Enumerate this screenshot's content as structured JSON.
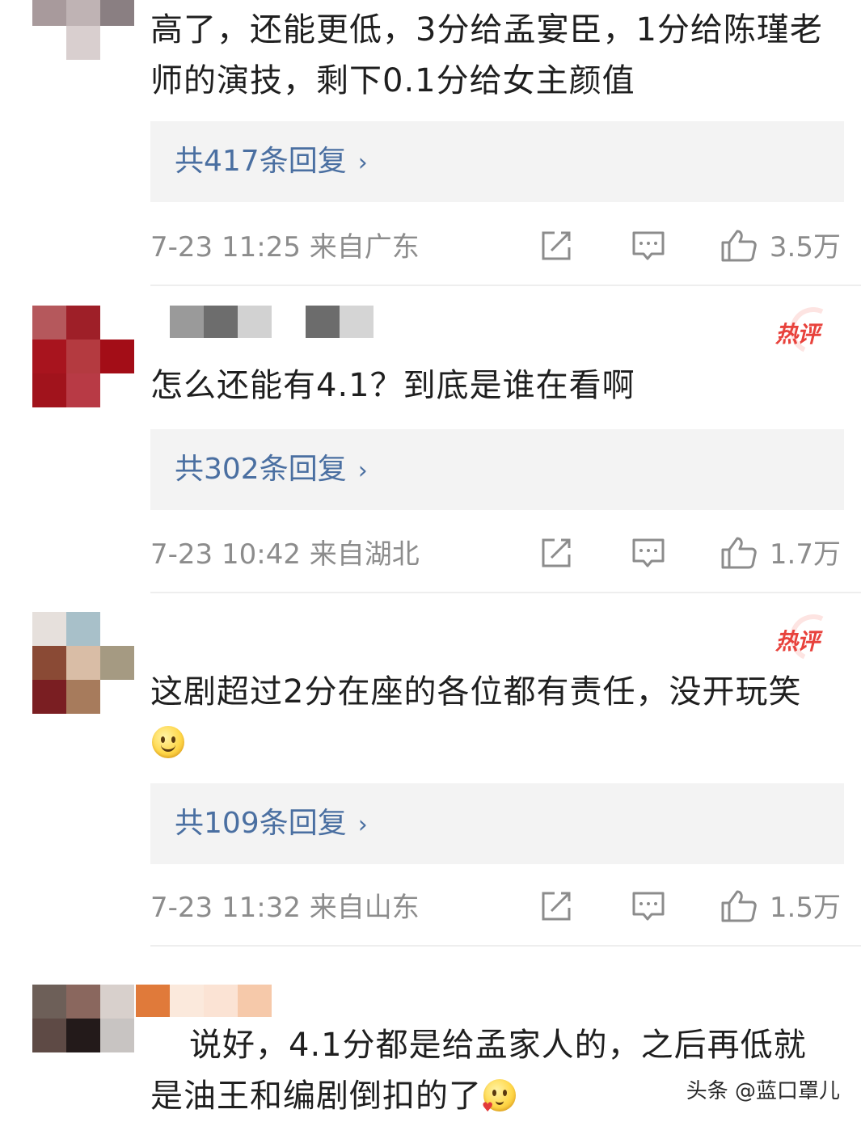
{
  "comments": [
    {
      "text": "高了，还能更低，3分给孟宴臣，1分给陈瑾老师的演技，剩下0.1分给女主颜值",
      "reply_label": "共417条回复",
      "time": "7-23 11:25",
      "location": "来自广东",
      "likes": "3.5万"
    },
    {
      "badge": "热评",
      "text": "怎么还能有4.1？到底是谁在看啊",
      "reply_label": "共302条回复",
      "time": "7-23 10:42",
      "location": "来自湖北",
      "likes": "1.7万"
    },
    {
      "badge": "热评",
      "text": "这剧超过2分在座的各位都有责任，没开玩笑",
      "reply_label": "共109条回复",
      "time": "7-23 11:32",
      "location": "来自山东",
      "likes": "1.5万"
    },
    {
      "text": "说好，4.1分都是给孟家人的，之后再低就是油王和编剧倒扣的了"
    }
  ],
  "chevron": "›",
  "watermark": "头条 @蓝口罩儿",
  "icons": [
    "share-icon",
    "comment-icon",
    "like-icon",
    "smile-emoji-icon",
    "kiss-emoji-icon"
  ],
  "colors": {
    "reply_link": "#4a6fa1",
    "hot_badge": "#e8423c",
    "meta": "#8c8c8c",
    "reply_bg": "#f3f3f3"
  }
}
